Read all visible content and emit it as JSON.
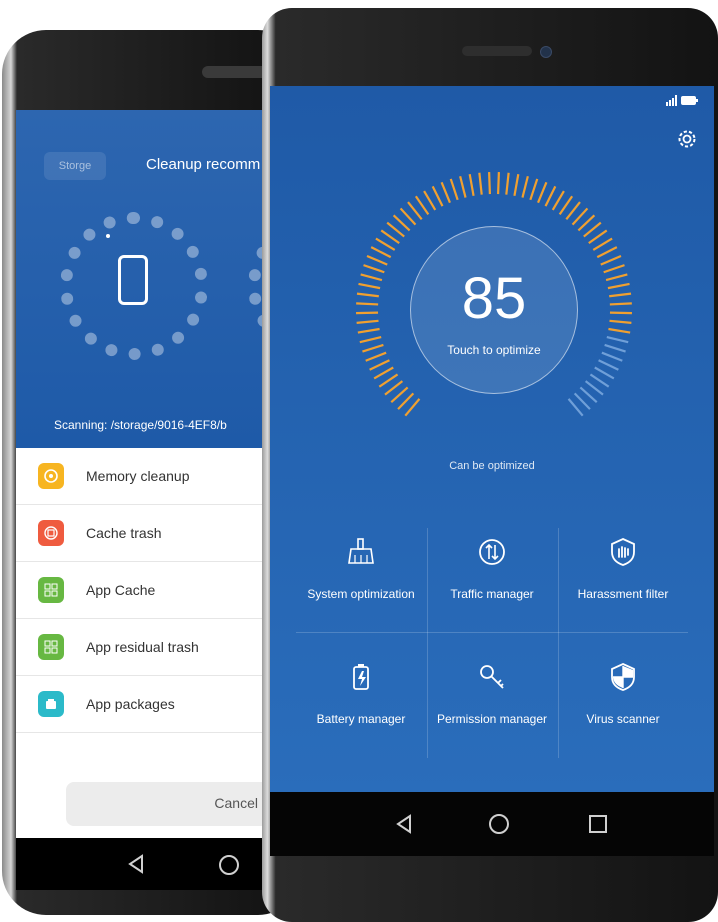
{
  "back_screen": {
    "storage_chip": "Storge",
    "title": "Cleanup recomm",
    "scanning": "Scanning: /storage/9016-4EF8/b",
    "items": [
      {
        "label": "Memory cleanup",
        "icon": "memory-icon",
        "color": "#f7b521"
      },
      {
        "label": "Cache trash",
        "icon": "cache-icon",
        "color": "#ef5b3f"
      },
      {
        "label": "App Cache",
        "icon": "app-cache-icon",
        "color": "#67b842"
      },
      {
        "label": "App residual trash",
        "icon": "app-residual-icon",
        "color": "#67b842"
      },
      {
        "label": "App packages",
        "icon": "app-packages-icon",
        "color": "#2bbac9"
      }
    ],
    "cancel_label": "Cancel"
  },
  "front_screen": {
    "score": "85",
    "touch_label": "Touch to optimize",
    "can_be_optimized": "Can be optimized",
    "tiles": [
      {
        "label": "System optimization",
        "icon": "broom-icon"
      },
      {
        "label": "Traffic manager",
        "icon": "traffic-icon"
      },
      {
        "label": "Harassment filter",
        "icon": "hand-shield-icon"
      },
      {
        "label": "Battery manager",
        "icon": "battery-icon"
      },
      {
        "label": "Permission manager",
        "icon": "key-icon"
      },
      {
        "label": "Virus scanner",
        "icon": "shield-icon"
      }
    ]
  },
  "colors": {
    "blue": "#1f5aa7",
    "ring_orange": "#f0a030",
    "ring_dim": "#6f9fd8"
  }
}
